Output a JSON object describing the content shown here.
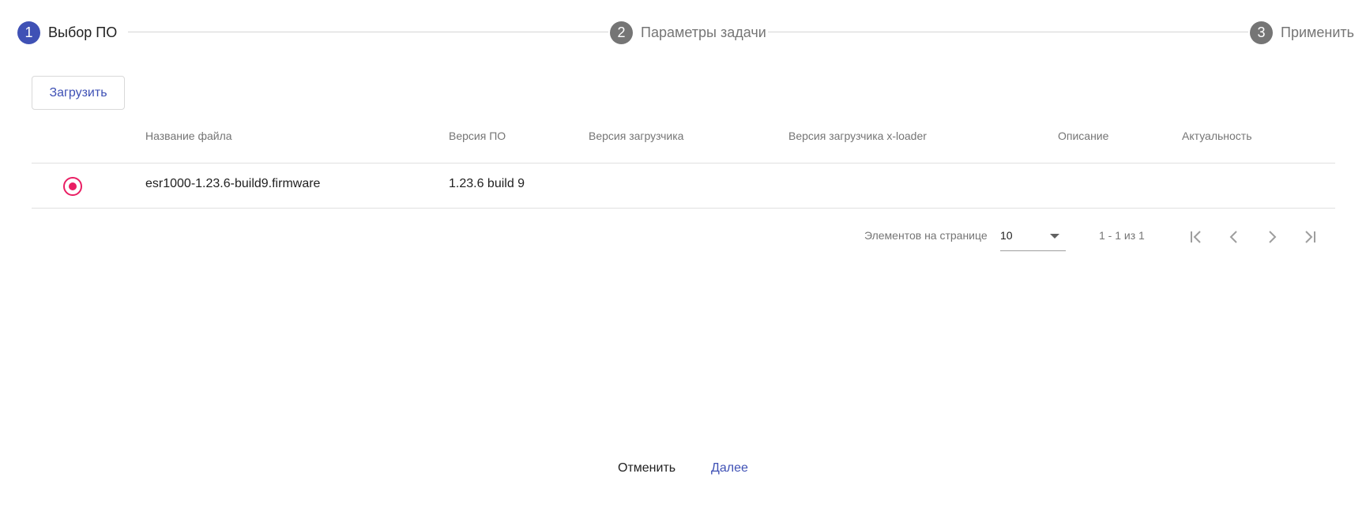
{
  "stepper": {
    "steps": [
      {
        "number": "1",
        "label": "Выбор ПО",
        "active": true
      },
      {
        "number": "2",
        "label": "Параметры задачи",
        "active": false
      },
      {
        "number": "3",
        "label": "Применить",
        "active": false
      }
    ]
  },
  "toolbar": {
    "upload_label": "Загрузить"
  },
  "table": {
    "columns": [
      "Название файла",
      "Версия ПО",
      "Версия загрузчика",
      "Версия загрузчика x-loader",
      "Описание",
      "Актуальность"
    ],
    "rows": [
      {
        "selected": true,
        "file_name": "esr1000-1.23.6-build9.firmware",
        "fw_version": "1.23.6 build 9",
        "loader_version": "",
        "xloader_version": "",
        "description": "",
        "actuality": ""
      }
    ]
  },
  "paginator": {
    "items_per_page_label": "Элементов на странице",
    "page_size": "10",
    "range_label": "1 - 1 из 1"
  },
  "actions": {
    "cancel_label": "Отменить",
    "next_label": "Далее"
  },
  "colors": {
    "primary": "#3f51b5",
    "accent": "#e91e63",
    "inactive": "#757575"
  }
}
